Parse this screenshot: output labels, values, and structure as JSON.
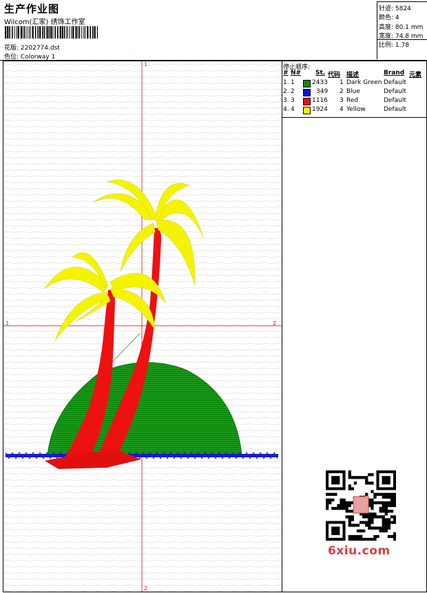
{
  "header": {
    "title": "生产作业图",
    "company": "Wilcom(汇家) 绣饰工作室",
    "design_label": "花版:",
    "design_value": "2202774.dst",
    "colorway_label": "色位:",
    "colorway_value": "Colorway 1"
  },
  "stats": [
    {
      "label": "针迹:",
      "value": "5824"
    },
    {
      "label": "颜色:",
      "value": "4"
    },
    {
      "label": "高度:",
      "value": "80.1 mm"
    },
    {
      "label": "宽度:",
      "value": "74.8 mm"
    },
    {
      "label": "比例:",
      "value": "1.78"
    }
  ],
  "axes": {
    "top": "1",
    "bottom": "2",
    "left": "1",
    "right": "2"
  },
  "stop_sequence": {
    "title": "停止顺序:",
    "columns": [
      "#",
      "N#",
      "St.",
      "代码",
      "描述",
      "Brand",
      "元素"
    ],
    "rows": [
      {
        "num": "1.",
        "n": "1",
        "stitches": "2433",
        "code": "1",
        "desc": "Dark Green",
        "brand": "Default",
        "color": "#118811"
      },
      {
        "num": "2.",
        "n": "2",
        "stitches": "349",
        "code": "2",
        "desc": "Blue",
        "brand": "Default",
        "color": "#1010e0"
      },
      {
        "num": "3.",
        "n": "3",
        "stitches": "1116",
        "code": "3",
        "desc": "Red",
        "brand": "Default",
        "color": "#ee1111"
      },
      {
        "num": "4.",
        "n": "4",
        "stitches": "1924",
        "code": "4",
        "desc": "Yellow",
        "brand": "Default",
        "color": "#f2f200"
      }
    ]
  },
  "watermark": "6xiu.com",
  "colors": {
    "crosshair": "#ee0000",
    "axis_label_green": "#00aa00",
    "axis_label_red": "#ee0000"
  }
}
